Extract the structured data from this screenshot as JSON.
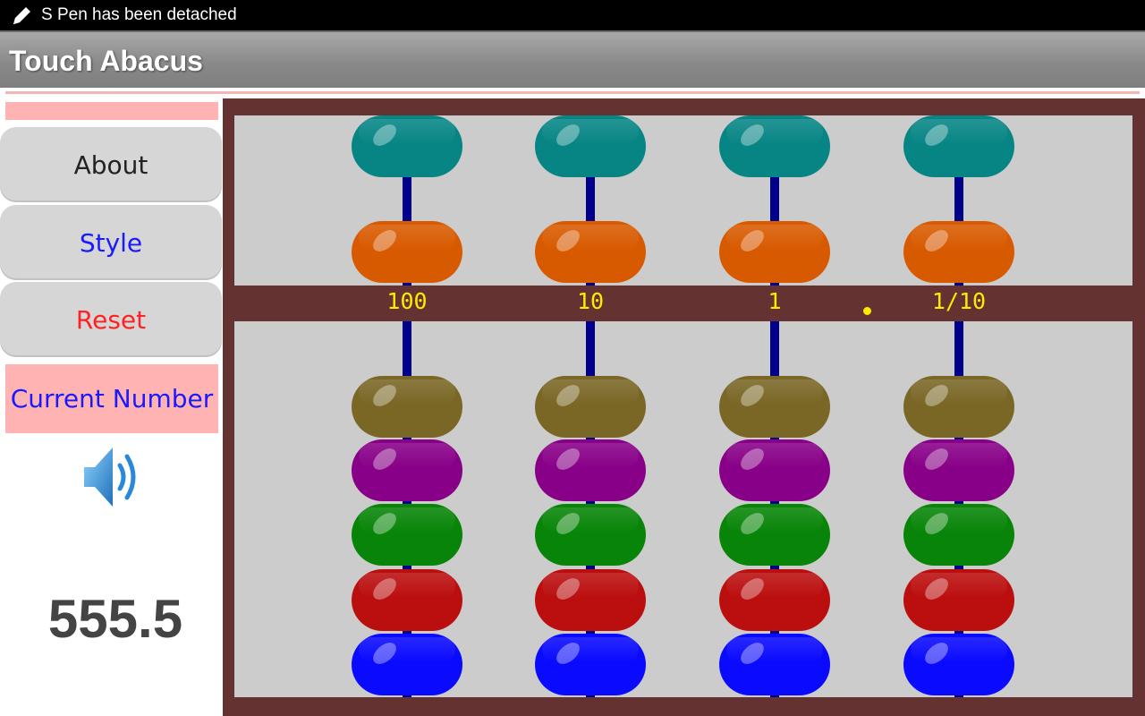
{
  "status_bar": {
    "message": "S Pen has been detached",
    "icon": "pen-icon"
  },
  "app": {
    "title": "Touch Abacus"
  },
  "sidebar": {
    "buttons": [
      {
        "label": "About",
        "color": "#222222"
      },
      {
        "label": "Style",
        "color": "#1a1aff"
      },
      {
        "label": "Reset",
        "color": "#ff2222"
      }
    ],
    "current_number_label": "Current Number",
    "speaker_icon": "speaker-icon",
    "value": "555.5"
  },
  "abacus": {
    "place_labels": [
      "100",
      "10",
      "1",
      "1/10"
    ],
    "colors": {
      "frame": "#653232",
      "panel": "#cccccc",
      "rod": "#00008b",
      "label": "#ffea00",
      "heaven_beads": [
        "#078585",
        "#d85a00"
      ],
      "earth_beads": [
        "#7a6726",
        "#880088",
        "#088508",
        "#bb0f0f",
        "#0a0aff"
      ]
    }
  }
}
